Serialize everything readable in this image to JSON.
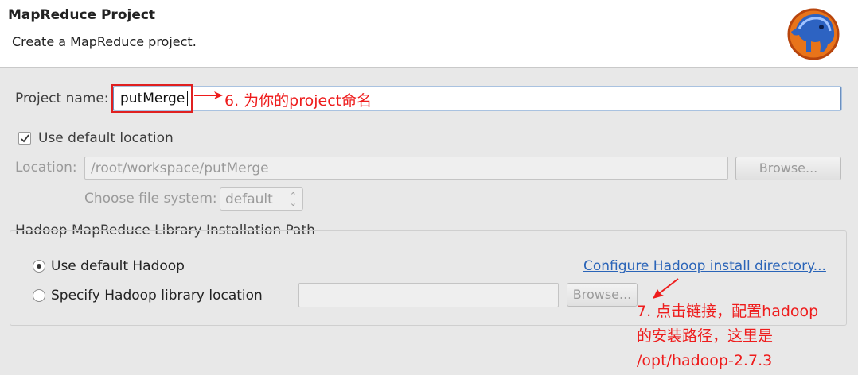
{
  "banner": {
    "title": "MapReduce Project",
    "description": "Create a MapReduce project.",
    "logo_icon": "hadoop-elephant-logo"
  },
  "project": {
    "name_label": "Project name:",
    "name_value": "putMerge"
  },
  "location": {
    "use_default_label": "Use default location",
    "use_default_checked": true,
    "location_label": "Location:",
    "location_value": "/root/workspace/putMerge",
    "browse_label": "Browse...",
    "fs_label": "Choose file system:",
    "fs_value": "default"
  },
  "hadoop": {
    "group_title": "Hadoop MapReduce Library Installation Path",
    "use_default_label": "Use default Hadoop",
    "specify_label": "Specify Hadoop library location",
    "configure_link": "Configure Hadoop install directory...",
    "library_path": "",
    "browse_label": "Browse...",
    "selected": "default"
  },
  "annotations": {
    "note6": "6. 为你的project命名",
    "note7_lines": [
      "7. 点击链接，配置hadoop",
      "的安装路径，这里是",
      "/opt/hadoop-2.7.3"
    ],
    "color": "#ee1c1c"
  }
}
